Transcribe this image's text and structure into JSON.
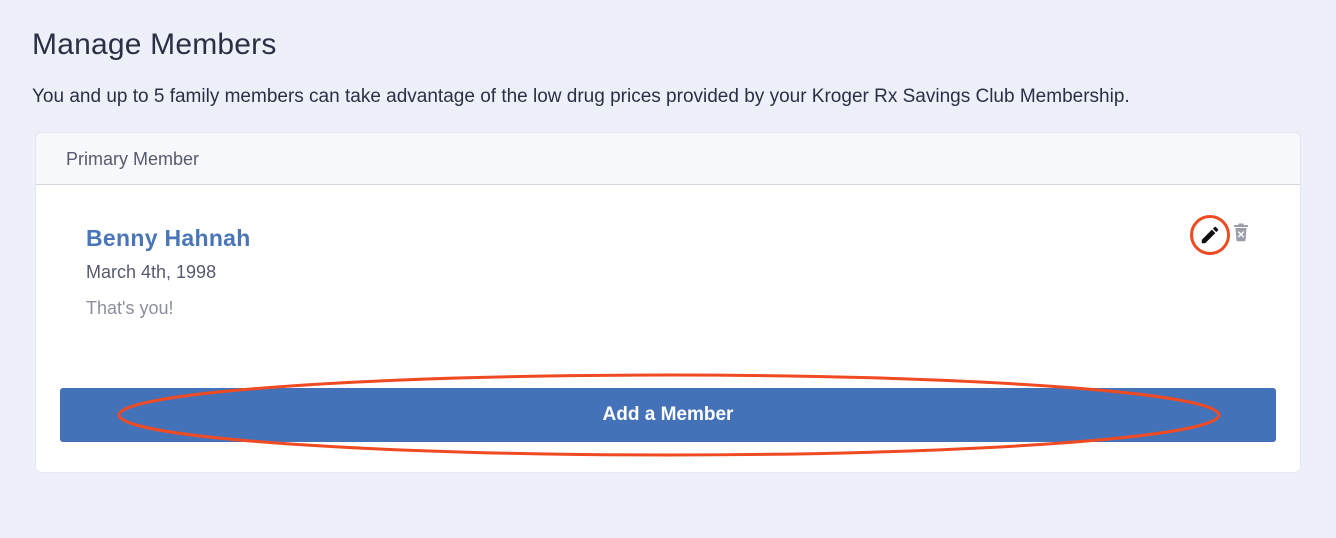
{
  "page": {
    "title": "Manage Members",
    "description": "You and up to 5 family members can take advantage of the low drug prices provided by your Kroger Rx Savings Club Membership."
  },
  "card": {
    "header": "Primary Member",
    "member": {
      "name": "Benny Hahnah",
      "dob": "March 4th, 1998",
      "note": "That's you!"
    },
    "icons": {
      "edit": "pencil-icon",
      "delete": "trash-icon"
    },
    "add_button_label": "Add a Member"
  },
  "colors": {
    "background": "#edf0f8",
    "accent": "#4472b9",
    "name": "#4a76b8",
    "highlight": "#f04a22"
  }
}
